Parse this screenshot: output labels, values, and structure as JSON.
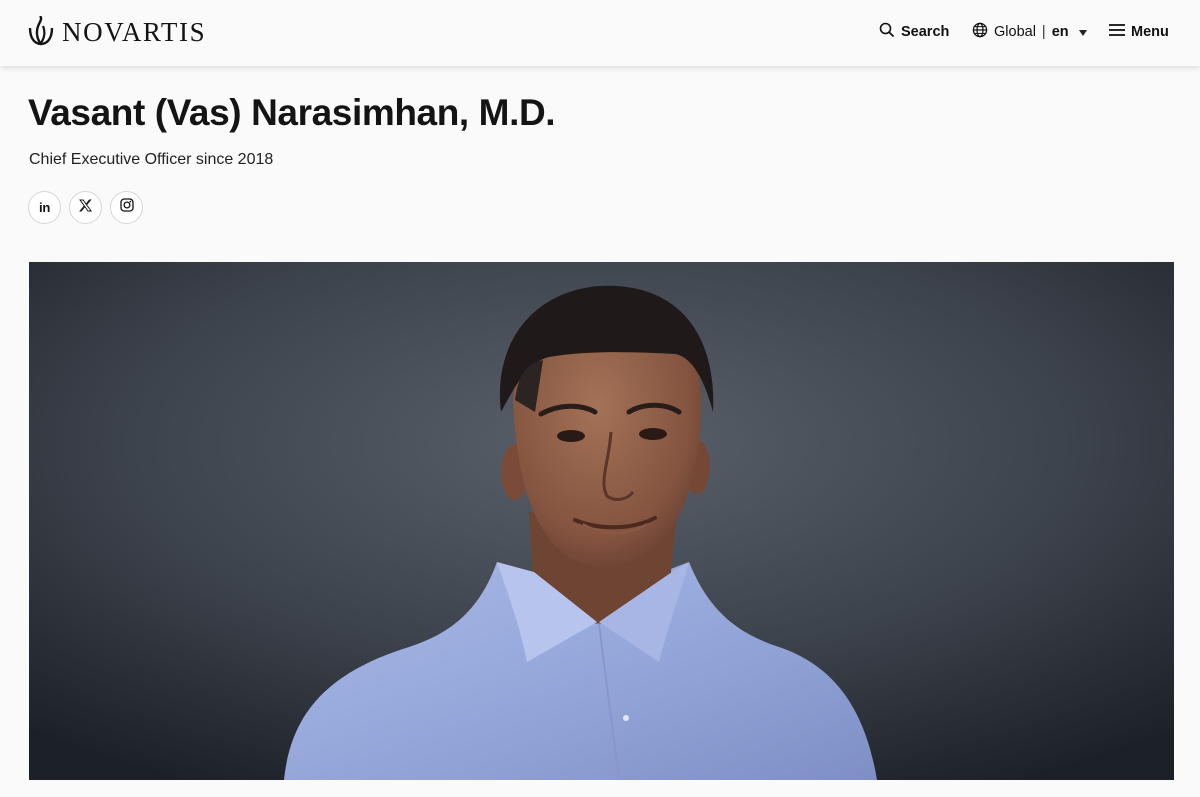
{
  "header": {
    "logo_text": "NOVARTIS",
    "search_label": "Search",
    "region_label": "Global",
    "separator": "|",
    "language_code": "en",
    "menu_label": "Menu"
  },
  "profile": {
    "name": "Vasant (Vas) Narasimhan, M.D.",
    "role": "Chief Executive Officer since 2018",
    "social": [
      "linkedin",
      "x",
      "instagram"
    ],
    "linkedin_label": "in"
  },
  "hero": {
    "description": "portrait-photo"
  },
  "colors": {
    "page_background": "#fafafa",
    "text": "#141414",
    "hero_background": "#3a3f46"
  }
}
